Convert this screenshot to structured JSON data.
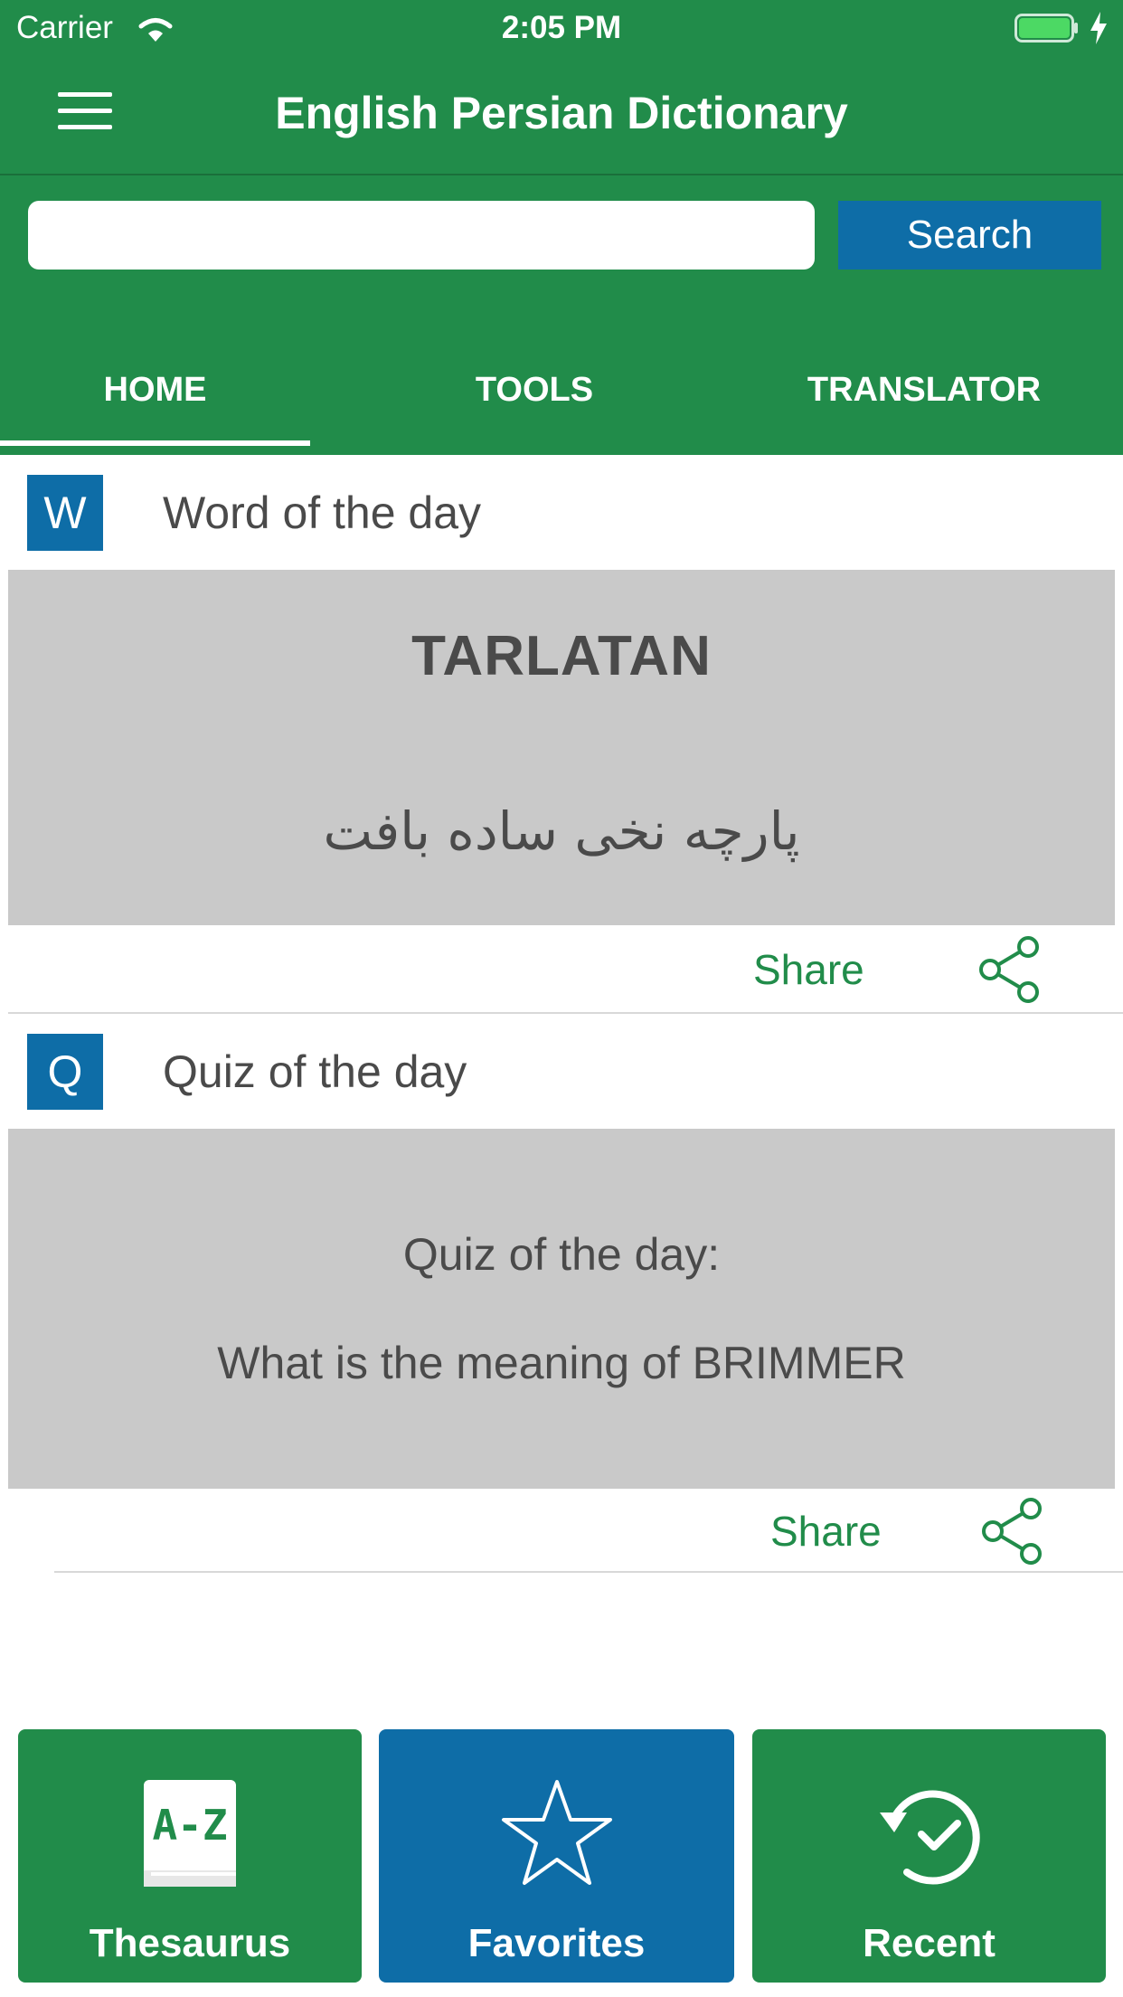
{
  "status_bar": {
    "carrier": "Carrier",
    "time": "2:05 PM"
  },
  "header": {
    "title": "English Persian Dictionary",
    "menu_icon": "hamburger-menu-icon"
  },
  "search": {
    "value": "",
    "placeholder": "",
    "button_label": "Search"
  },
  "tabs": [
    {
      "label": "HOME",
      "selected": true
    },
    {
      "label": "TOOLS",
      "selected": false
    },
    {
      "label": "TRANSLATOR",
      "selected": false
    }
  ],
  "word_of_day": {
    "badge": "W",
    "title": "Word of the day",
    "word": "TARLATAN",
    "translation": "پارچه نخی ساده بافت",
    "share_label": "Share",
    "share_icon": "share-icon"
  },
  "quiz_of_day": {
    "badge": "Q",
    "title": "Quiz of the day",
    "line1": "Quiz of the day:",
    "line2": "What is the meaning of BRIMMER",
    "share_label": "Share",
    "share_icon": "share-icon"
  },
  "bottom_bar": [
    {
      "label": "Thesaurus",
      "icon": "book-a-z-icon",
      "color": "#218c4a"
    },
    {
      "label": "Favorites",
      "icon": "star-icon",
      "color": "#0e6da7"
    },
    {
      "label": "Recent",
      "icon": "history-clock-icon",
      "color": "#218c4a"
    }
  ],
  "colors": {
    "primary": "#218c4a",
    "accent": "#0e6da7",
    "card": "#c9c9c9"
  }
}
